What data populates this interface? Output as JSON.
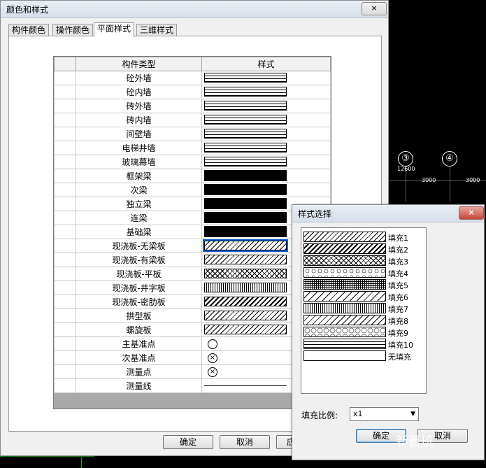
{
  "cad": {
    "axis_labels": [
      "③",
      "④"
    ],
    "dims": [
      "12600",
      "3000",
      "3000"
    ]
  },
  "main_dialog": {
    "title": "颜色和样式",
    "close_label": "×",
    "tabs": [
      "构件颜色",
      "操作颜色",
      "平面样式",
      "三维样式"
    ],
    "grid": {
      "headers": [
        "构件类型",
        "样式"
      ],
      "rows": [
        {
          "name": "砼外墙",
          "style": "wall"
        },
        {
          "name": "砼内墙",
          "style": "wall"
        },
        {
          "name": "砖外墙",
          "style": "wall"
        },
        {
          "name": "砖内墙",
          "style": "wall"
        },
        {
          "name": "间壁墙",
          "style": "wall"
        },
        {
          "name": "电梯井墙",
          "style": "wall"
        },
        {
          "name": "玻璃幕墙",
          "style": "wall"
        },
        {
          "name": "框架梁",
          "style": "solid"
        },
        {
          "name": "次梁",
          "style": "solid"
        },
        {
          "name": "独立梁",
          "style": "solid"
        },
        {
          "name": "连梁",
          "style": "solid"
        },
        {
          "name": "基础梁",
          "style": "solid"
        },
        {
          "name": "现浇板-无梁板",
          "style": "diag-sel"
        },
        {
          "name": "现浇板-有梁板",
          "style": "diag"
        },
        {
          "name": "现浇板-平板",
          "style": "cross"
        },
        {
          "name": "现浇板-井字板",
          "style": "brick"
        },
        {
          "name": "现浇板-密肋板",
          "style": "dash"
        },
        {
          "name": "拱型板",
          "style": "diag"
        },
        {
          "name": "螺旋板",
          "style": "diag"
        },
        {
          "name": "主基准点",
          "style": "circle"
        },
        {
          "name": "次基准点",
          "style": "circle-x"
        },
        {
          "name": "测量点",
          "style": "circle-x"
        },
        {
          "name": "测量线",
          "style": "line"
        }
      ]
    },
    "buttons": {
      "ok": "确定",
      "cancel": "取消",
      "apply": "应"
    }
  },
  "sub_dialog": {
    "title": "样式选择",
    "close_label": "×",
    "fills": [
      "填充1",
      "填充2",
      "填充3",
      "填充4",
      "填充5",
      "填充6",
      "填充7",
      "填充8",
      "填充9",
      "填充10",
      "无填充"
    ],
    "scale_label": "填充比例:",
    "scale_value": "x1",
    "buttons": {
      "ok": "确定",
      "cancel": "取消"
    }
  },
  "watermark": "新普班"
}
